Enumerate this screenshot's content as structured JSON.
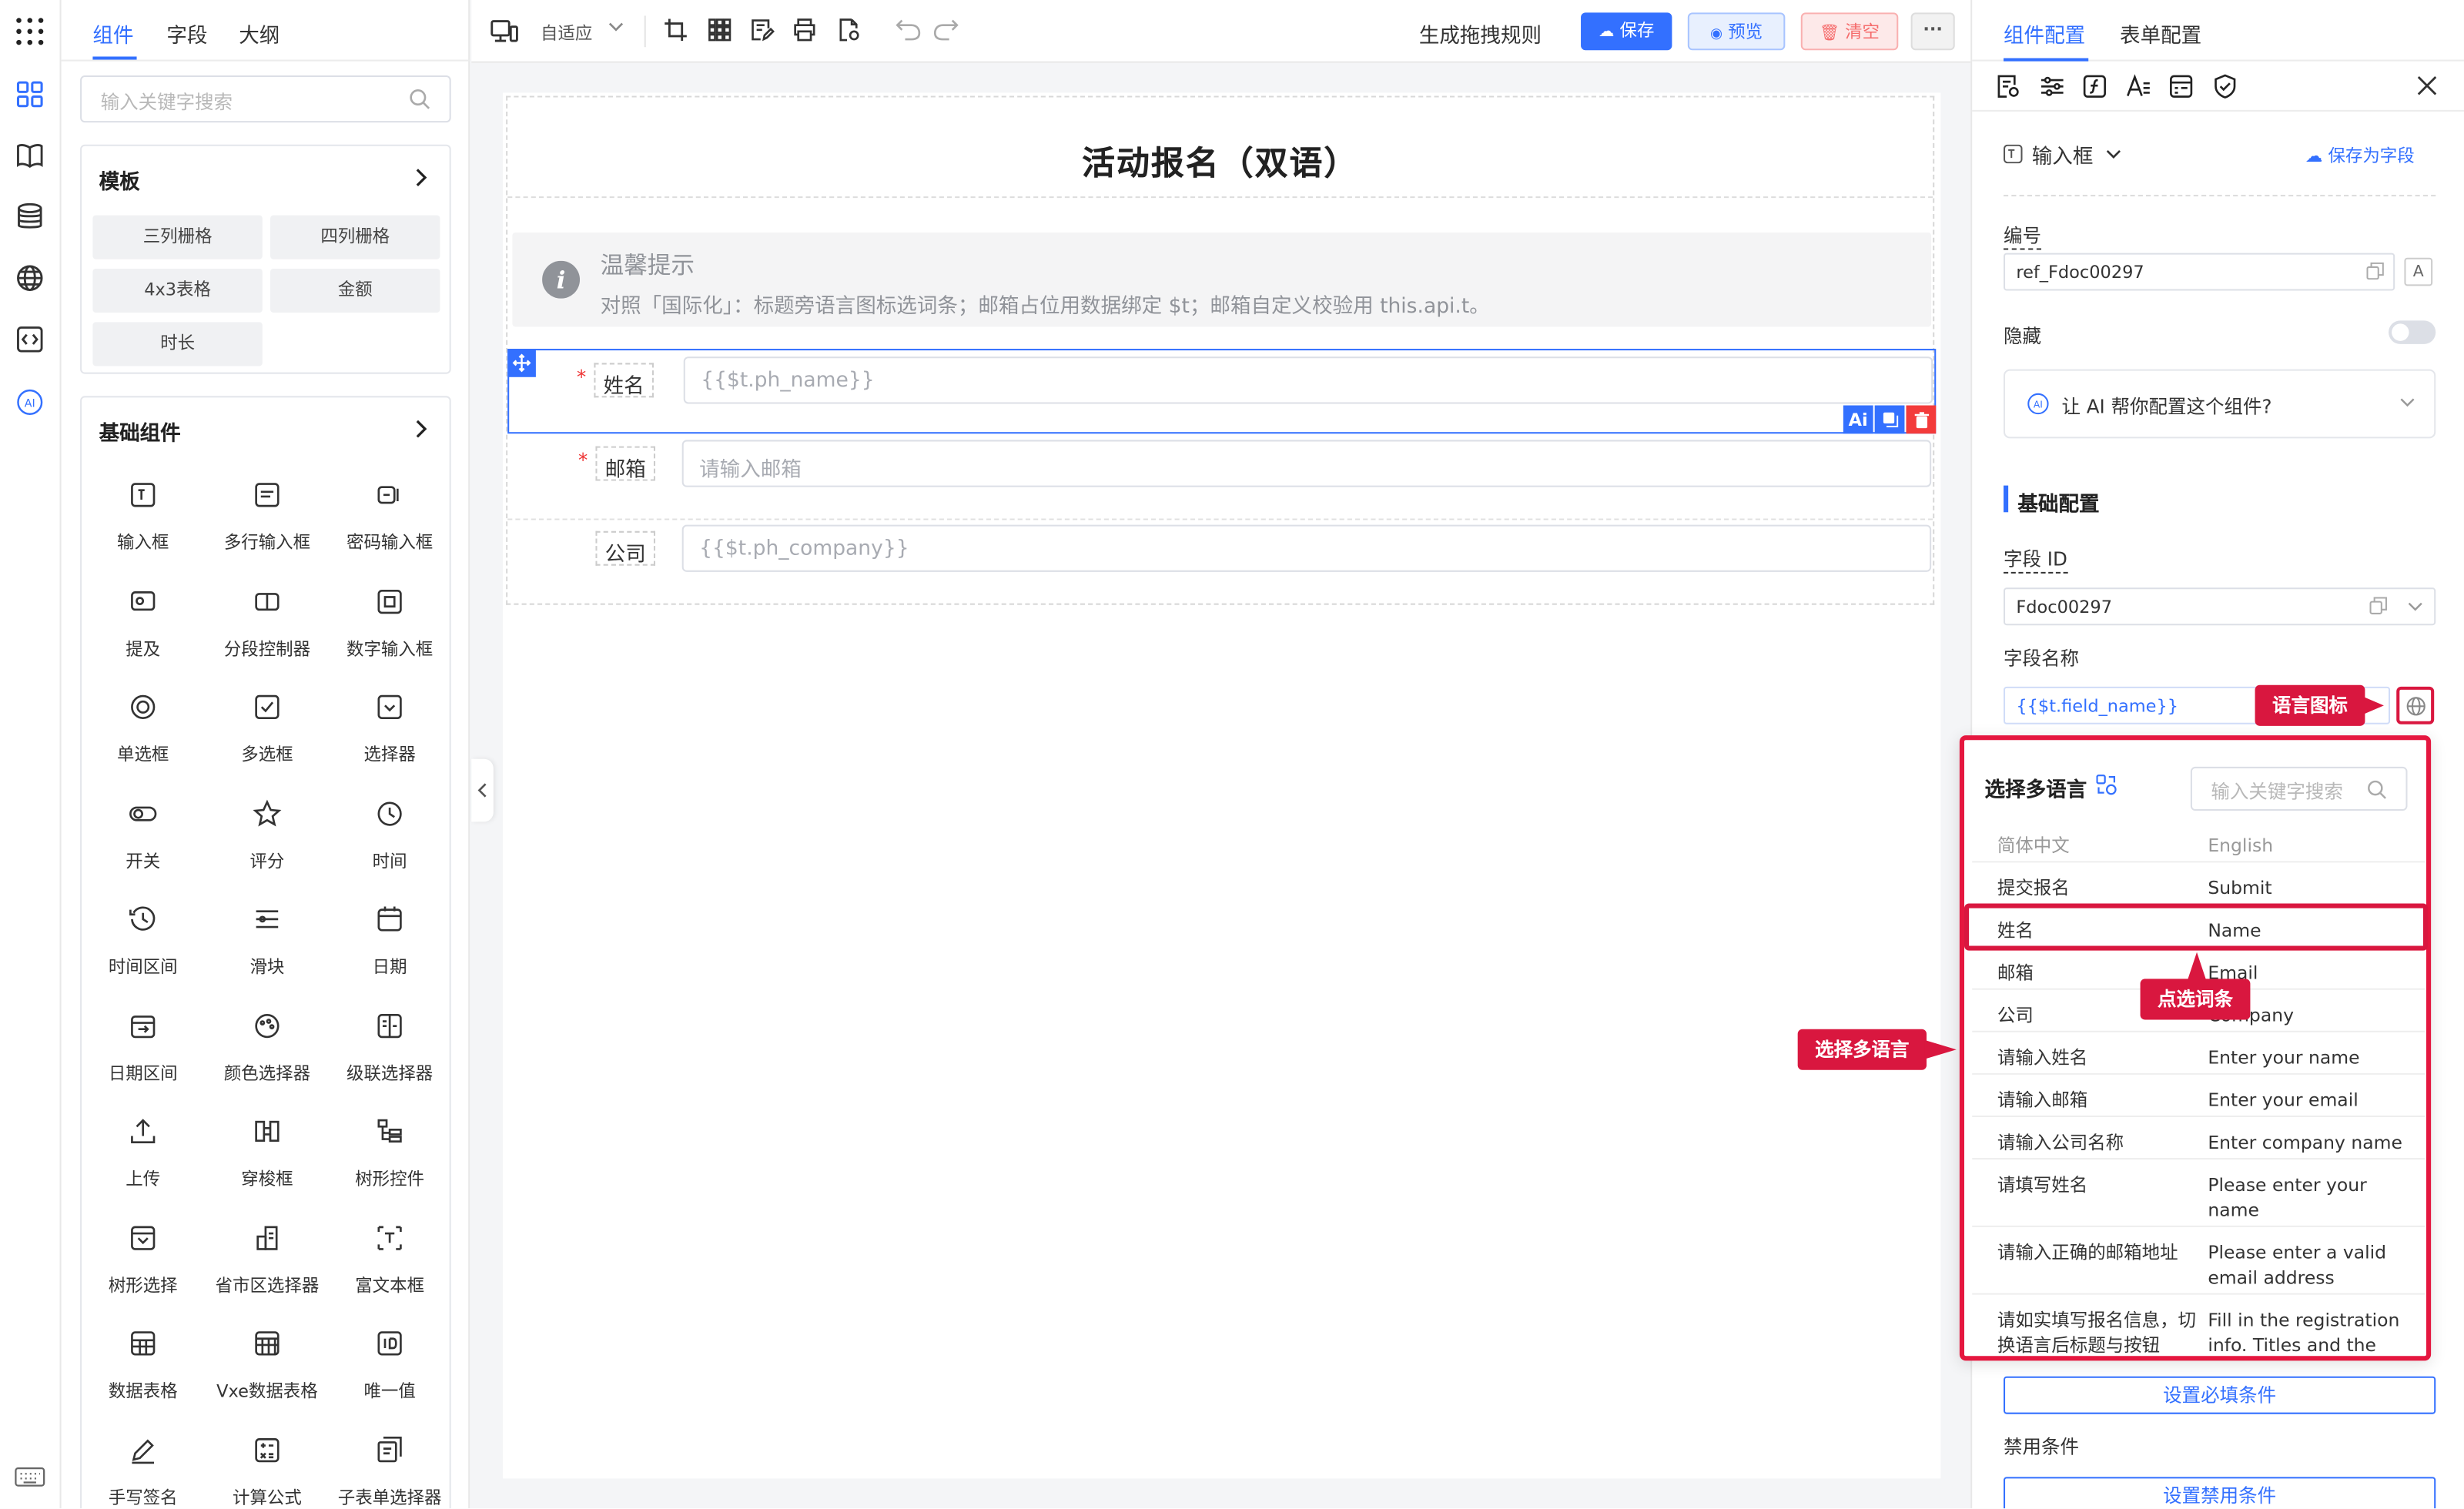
{
  "rail": {
    "icons": [
      "apps-grid-icon",
      "components-icon",
      "book-icon",
      "database-icon",
      "globe-icon",
      "code-icon",
      "ai-icon",
      "keyboard-icon"
    ]
  },
  "left": {
    "tabs": [
      "组件",
      "字段",
      "大纲"
    ],
    "search_placeholder": "输入关键字搜索",
    "templates": {
      "title": "模板",
      "items": [
        "三列栅格",
        "四列栅格",
        "4x3表格",
        "金额",
        "时长"
      ]
    },
    "basic": {
      "title": "基础组件",
      "items": [
        "输入框",
        "多行输入框",
        "密码输入框",
        "提及",
        "分段控制器",
        "数字输入框",
        "单选框",
        "多选框",
        "选择器",
        "开关",
        "评分",
        "时间",
        "时间区间",
        "滑块",
        "日期",
        "日期区间",
        "颜色选择器",
        "级联选择器",
        "上传",
        "穿梭框",
        "树形控件",
        "树形选择",
        "省市区选择器",
        "富文本框",
        "数据表格",
        "Vxe数据表格",
        "唯一值",
        "手写签名",
        "计算公式",
        "子表单选择器"
      ]
    }
  },
  "toolbar": {
    "adapt": "自适应",
    "rule": "生成拖拽规则",
    "save": "保存",
    "preview": "预览",
    "clear": "清空"
  },
  "form": {
    "title": "活动报名（双语）",
    "tip_title": "温馨提示",
    "tip_text": "对照「国际化」：标题旁语言图标选词条；邮箱占位用数据绑定 $t；邮箱自定义校验用 this.api.t。",
    "fields": [
      {
        "label": "姓名",
        "required": true,
        "placeholder": "{{$t.ph_name}}"
      },
      {
        "label": "邮箱",
        "required": true,
        "placeholder": "请输入邮箱"
      },
      {
        "label": "公司",
        "required": false,
        "placeholder": "{{$t.ph_company}}"
      }
    ],
    "ai_badge": "Ai"
  },
  "right": {
    "tabs": [
      "组件配置",
      "表单配置"
    ],
    "comp_type": "输入框",
    "save_as_field": "保存为字段",
    "id_label": "编号",
    "id_value": "ref_Fdoc00297",
    "hidden_label": "隐藏",
    "hidden_on": false,
    "ai_prompt": "让 AI 帮你配置这个组件?",
    "section": "基础配置",
    "field_id_label": "字段 ID",
    "field_id_value": "Fdoc00297",
    "field_name_label": "字段名称",
    "field_name_value": "{{$t.field_name}}",
    "required_btn": "设置必填条件",
    "disabled_label": "禁用条件",
    "disabled_btn": "设置禁用条件"
  },
  "i18n": {
    "title": "选择多语言",
    "search_placeholder": "输入关键字搜索",
    "header": [
      "简体中文",
      "English"
    ],
    "rows": [
      [
        "提交报名",
        "Submit"
      ],
      [
        "姓名",
        "Name"
      ],
      [
        "邮箱",
        "Email"
      ],
      [
        "公司",
        "Company"
      ],
      [
        "请输入姓名",
        "Enter your name"
      ],
      [
        "请输入邮箱",
        "Enter your email"
      ],
      [
        "请输入公司名称",
        "Enter company name"
      ],
      [
        "请填写姓名",
        "Please enter your name"
      ],
      [
        "请输入正确的邮箱地址",
        "Please enter a valid email address"
      ],
      [
        "请如实填写报名信息，切换语言后标题与按钮",
        "Fill in the registration info. Titles and the"
      ]
    ]
  },
  "callouts": {
    "lang_icon": "语言图标",
    "pick_entry": "点选词条",
    "pick_lang": "选择多语言"
  },
  "colors": {
    "accent": "#3370ff",
    "callout": "#d9173f",
    "danger": "#f56c6c"
  }
}
